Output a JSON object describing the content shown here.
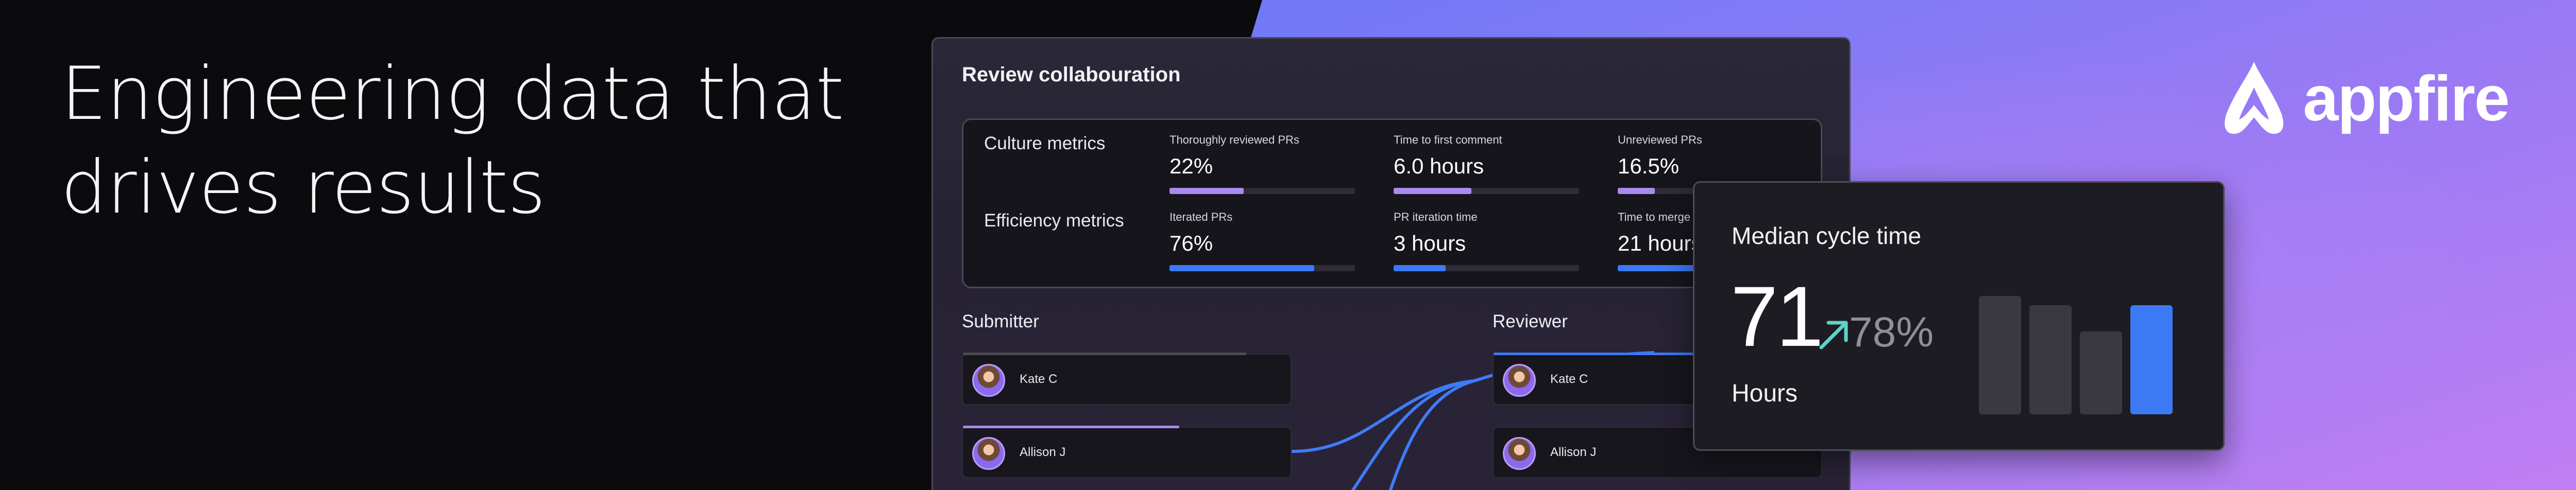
{
  "headline": {
    "line1": "Engineering data that",
    "line2": "drives results"
  },
  "panel": {
    "title": "Review collabouration",
    "culture_label": "Culture metrics",
    "efficiency_label": "Efficiency metrics",
    "culture_metrics": [
      {
        "label": "Thoroughly reviewed PRs",
        "value": "22%",
        "progress": 0.4,
        "color": "#a98bf0"
      },
      {
        "label": "Time to first comment",
        "value": "6.0 hours",
        "progress": 0.42,
        "color": "#a98bf0"
      },
      {
        "label": "Unreviewed PRs",
        "value": "16.5%",
        "progress": 0.2,
        "color": "#a98bf0"
      }
    ],
    "efficiency_metrics": [
      {
        "label": "Iterated PRs",
        "value": "76%",
        "progress": 0.78,
        "color": "#3b79f5"
      },
      {
        "label": "PR iteration time",
        "value": "3 hours",
        "progress": 0.28,
        "color": "#3b79f5"
      },
      {
        "label": "Time to merge",
        "value": "21 hours",
        "progress": 0.55,
        "color": "#3b79f5"
      }
    ],
    "submitter_label": "Submitter",
    "reviewer_label": "Reviewer",
    "submitters": [
      {
        "name": "Kate C"
      },
      {
        "name": "Allison J"
      }
    ],
    "reviewers": [
      {
        "name": "Kate C"
      },
      {
        "name": "Allison J"
      }
    ]
  },
  "cycle_card": {
    "title": "Median cycle time",
    "value": "71",
    "change": "78%",
    "unit": "Hours",
    "bar_levels": [
      1.0,
      0.92,
      0.7,
      0.92
    ],
    "highlight_color": "#3b79f5",
    "arrow_color": "#5fd3c8"
  },
  "logo": {
    "text": "appfire",
    "mark_icon": "appfire-logo-icon"
  },
  "colors": {
    "bg_dark": "#0b0b0e",
    "gradient_start": "#6c79f7",
    "gradient_end": "#c27ef2",
    "accent_purple": "#a98bf0",
    "accent_blue": "#3b79f5"
  }
}
